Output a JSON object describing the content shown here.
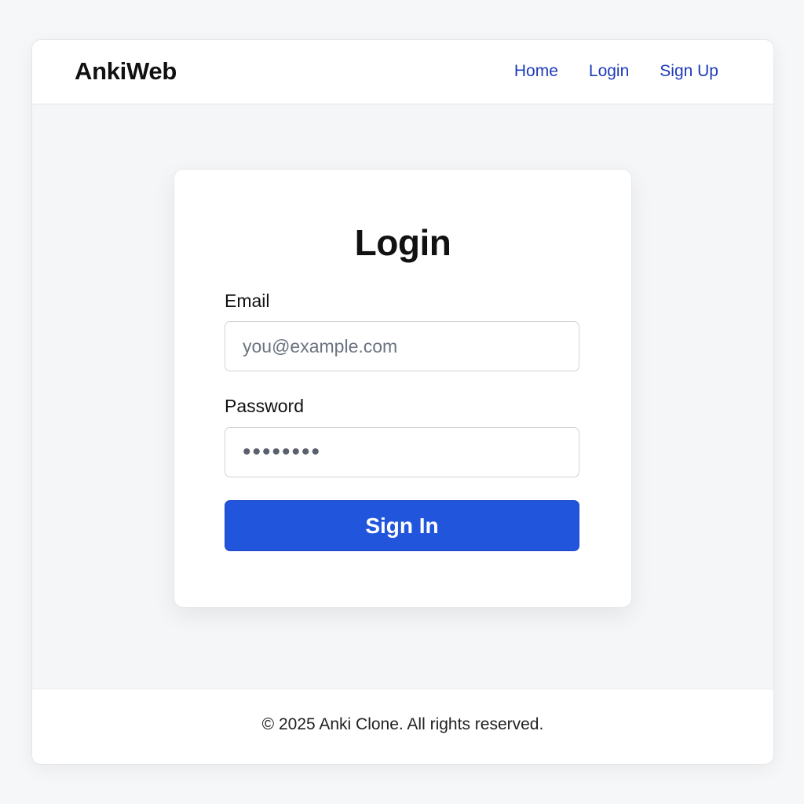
{
  "header": {
    "brand": "AnkiWeb",
    "nav": [
      {
        "label": "Home"
      },
      {
        "label": "Login"
      },
      {
        "label": "Sign Up"
      }
    ]
  },
  "login_card": {
    "title": "Login",
    "email": {
      "label": "Email",
      "placeholder": "you@example.com",
      "value": ""
    },
    "password": {
      "label": "Password",
      "masked_value": "••••••••"
    },
    "submit_label": "Sign In"
  },
  "footer": {
    "text": "© 2025 Anki Clone. All rights reserved."
  },
  "colors": {
    "accent": "#2155dc",
    "link": "#1d3bb8"
  }
}
